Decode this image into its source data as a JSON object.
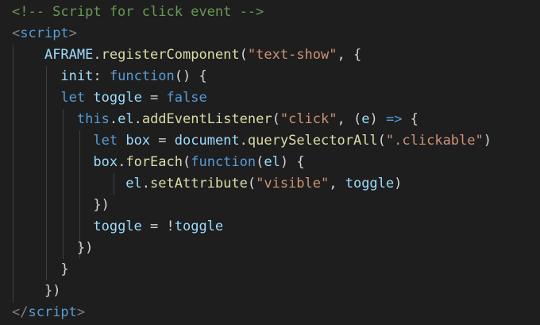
{
  "editor": {
    "background": "#1e1e1e",
    "lines": [
      [
        {
          "t": "<!-- Script for click event -->",
          "c": "comment"
        }
      ],
      [
        {
          "t": "<",
          "c": "punct"
        },
        {
          "t": "script",
          "c": "tag"
        },
        {
          "t": ">",
          "c": "punct"
        }
      ],
      [
        {
          "t": "    "
        },
        {
          "t": "AFRAME",
          "c": "var"
        },
        {
          "t": ".",
          "c": "text"
        },
        {
          "t": "registerComponent",
          "c": "fn"
        },
        {
          "t": "(",
          "c": "text"
        },
        {
          "t": "\"text-show\"",
          "c": "str"
        },
        {
          "t": ", {",
          "c": "text"
        }
      ],
      [
        {
          "t": "      "
        },
        {
          "t": "init",
          "c": "var"
        },
        {
          "t": ": ",
          "c": "text"
        },
        {
          "t": "function",
          "c": "kw"
        },
        {
          "t": "() {",
          "c": "text"
        }
      ],
      [
        {
          "t": "      "
        },
        {
          "t": "let",
          "c": "kw"
        },
        {
          "t": " ",
          "c": "text"
        },
        {
          "t": "toggle",
          "c": "var"
        },
        {
          "t": " = ",
          "c": "text"
        },
        {
          "t": "false",
          "c": "kw"
        }
      ],
      [
        {
          "t": "        "
        },
        {
          "t": "this",
          "c": "kw"
        },
        {
          "t": ".",
          "c": "text"
        },
        {
          "t": "el",
          "c": "var"
        },
        {
          "t": ".",
          "c": "text"
        },
        {
          "t": "addEventListener",
          "c": "fn"
        },
        {
          "t": "(",
          "c": "text"
        },
        {
          "t": "\"click\"",
          "c": "str"
        },
        {
          "t": ", (",
          "c": "text"
        },
        {
          "t": "e",
          "c": "var"
        },
        {
          "t": ") ",
          "c": "text"
        },
        {
          "t": "=>",
          "c": "kw"
        },
        {
          "t": " {",
          "c": "text"
        }
      ],
      [
        {
          "t": "          "
        },
        {
          "t": "let",
          "c": "kw"
        },
        {
          "t": " ",
          "c": "text"
        },
        {
          "t": "box",
          "c": "var"
        },
        {
          "t": " = ",
          "c": "text"
        },
        {
          "t": "document",
          "c": "var"
        },
        {
          "t": ".",
          "c": "text"
        },
        {
          "t": "querySelectorAll",
          "c": "fn"
        },
        {
          "t": "(",
          "c": "text"
        },
        {
          "t": "\".clickable\"",
          "c": "str"
        },
        {
          "t": ")",
          "c": "text"
        }
      ],
      [
        {
          "t": "          "
        },
        {
          "t": "box",
          "c": "var"
        },
        {
          "t": ".",
          "c": "text"
        },
        {
          "t": "forEach",
          "c": "fn"
        },
        {
          "t": "(",
          "c": "text"
        },
        {
          "t": "function",
          "c": "kw"
        },
        {
          "t": "(",
          "c": "text"
        },
        {
          "t": "el",
          "c": "var"
        },
        {
          "t": ") {",
          "c": "text"
        }
      ],
      [
        {
          "t": "              "
        },
        {
          "t": "el",
          "c": "var"
        },
        {
          "t": ".",
          "c": "text"
        },
        {
          "t": "setAttribute",
          "c": "fn"
        },
        {
          "t": "(",
          "c": "text"
        },
        {
          "t": "\"visible\"",
          "c": "str"
        },
        {
          "t": ", ",
          "c": "text"
        },
        {
          "t": "toggle",
          "c": "var"
        },
        {
          "t": ")",
          "c": "text"
        }
      ],
      [
        {
          "t": "          "
        },
        {
          "t": "})",
          "c": "text"
        }
      ],
      [
        {
          "t": "          "
        },
        {
          "t": "toggle",
          "c": "var"
        },
        {
          "t": " = !",
          "c": "text"
        },
        {
          "t": "toggle",
          "c": "var"
        }
      ],
      [
        {
          "t": "        "
        },
        {
          "t": "})",
          "c": "text"
        }
      ],
      [
        {
          "t": "      "
        },
        {
          "t": "}",
          "c": "text"
        }
      ],
      [
        {
          "t": "    "
        },
        {
          "t": "})",
          "c": "text"
        }
      ],
      [
        {
          "t": "</",
          "c": "punct"
        },
        {
          "t": "script",
          "c": "tag"
        },
        {
          "t": ">",
          "c": "punct"
        }
      ]
    ]
  }
}
